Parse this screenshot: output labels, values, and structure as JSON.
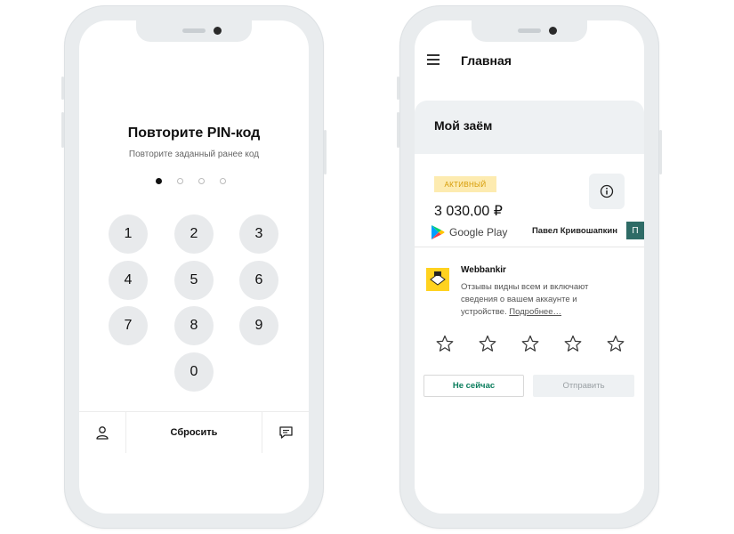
{
  "pin_screen": {
    "title": "Повторите PIN-код",
    "subtitle": "Повторите заданный ранее код",
    "pin_dots_filled": 1,
    "pin_dots_total": 4,
    "keys": [
      "1",
      "2",
      "3",
      "4",
      "5",
      "6",
      "7",
      "8",
      "9",
      "0"
    ],
    "reset_label": "Сбросить",
    "left_icon": "person-icon",
    "right_icon": "chat-icon"
  },
  "main_screen": {
    "header_title": "Главная",
    "loan_title": "Мой заём",
    "status_badge": "АКТИВНЫЙ",
    "amount": "3 030,00 ₽",
    "info_icon": "info-icon"
  },
  "review_sheet": {
    "store_name": "Google Play",
    "user_name": "Павел Кривошапкин",
    "user_initial": "П",
    "app_name": "Webbankir",
    "description": "Отзывы видны всем и включают сведения о вашем аккаунте и устройстве.",
    "more_link": "Подробнее…",
    "stars_count": 5,
    "not_now_label": "Не сейчас",
    "send_label": "Отправить"
  },
  "colors": {
    "accent_green": "#0a7d5c",
    "badge_bg": "#fdebb0",
    "badge_text": "#d59a00",
    "avatar_bg": "#2e6b66",
    "app_icon_bg": "#ffd21f"
  }
}
